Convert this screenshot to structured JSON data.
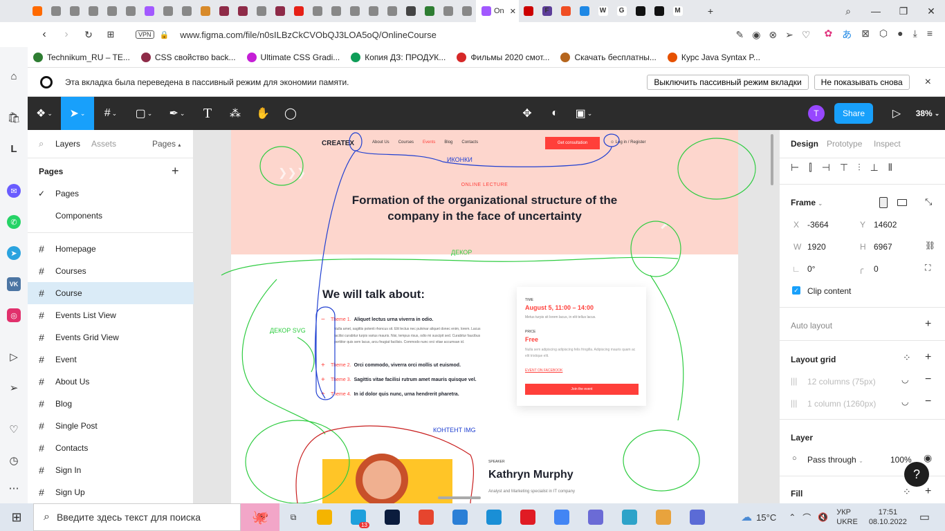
{
  "browser": {
    "active_tab_title": "On",
    "url": "www.figma.com/file/n0sILBzCkCVObQJ3LOA5oQ/OnlineCourse",
    "vpn_label": "VPN",
    "bookmarks": [
      {
        "label": "Technikum_RU – TE...",
        "color": "#2e7d32"
      },
      {
        "label": "CSS свойство back...",
        "color": "#8e2b48"
      },
      {
        "label": "Ultimate CSS Gradi...",
        "color": "#c51fd6"
      },
      {
        "label": "Копия ДЗ: ПРОДУК...",
        "color": "#0f9d58"
      },
      {
        "label": "Фильмы 2020 смот...",
        "color": "#d62828"
      },
      {
        "label": "Скачать бесплатны...",
        "color": "#b5651d"
      },
      {
        "label": "Курс Java Syntax P...",
        "color": "#e65100"
      }
    ],
    "tab_colors": [
      "#ff6a00",
      "#888",
      "#888",
      "#888",
      "#888",
      "#888",
      "#a259ff",
      "#888",
      "#888",
      "#d88a2a",
      "#8e2b48",
      "#8e2b48",
      "#888",
      "#8e2b48",
      "#e62117",
      "#888",
      "#888",
      "#888",
      "#888",
      "#888",
      "#444",
      "#2e7d32",
      "#888",
      "#888"
    ],
    "right_tab_colors": [
      "#c00",
      "#5c3d99",
      "#f04e23",
      "#1e88e5",
      "#fff",
      "#fff",
      "#111",
      "#111",
      "#fff"
    ],
    "right_tab_glyphs": [
      "",
      "F",
      "",
      "",
      "W",
      "G",
      "",
      "",
      "M"
    ]
  },
  "notice": {
    "text": "Эта вкладка была переведена в пассивный режим для экономии памяти.",
    "btn_disable": "Выключить пассивный режим вкладки",
    "btn_dont_show": "Не показывать снова",
    "close_glyph": "×"
  },
  "toolbar": {
    "avatar_letter": "T",
    "share_label": "Share",
    "zoom": "38%"
  },
  "left_panel": {
    "tab_layers": "Layers",
    "tab_assets": "Assets",
    "pages_dropdown": "Pages",
    "pages_header": "Pages",
    "page_items": [
      "Pages",
      "Components"
    ],
    "frames": [
      "Homepage",
      "Courses",
      "Course",
      "Events List View",
      "Events Grid View",
      "Event",
      "About Us",
      "Blog",
      "Single Post",
      "Contacts",
      "Sign In",
      "Sign Up"
    ],
    "selected_frame": "Course"
  },
  "design": {
    "logo": "CREATEX",
    "nav": [
      "About Us",
      "Courses",
      "Events",
      "Blog",
      "Contacts"
    ],
    "nav_active": "Events",
    "cta": "Get consultation",
    "login": "Log in / Register",
    "eyebrow": "ONLINE LECTURE",
    "title_line1": "Formation of the organizational structure of the",
    "title_line2": "company in the face of uncertainty",
    "talk_heading": "We will talk about:",
    "themes": [
      {
        "num": "Theme 1.",
        "text": "Aliquet lectus urna viverra in odio."
      },
      {
        "num": "Theme 2.",
        "text": "Orci commodo, viverra orci mollis ut euismod."
      },
      {
        "num": "Theme 3.",
        "text": "Sagittis vitae facilisi rutrum amet mauris quisque vel."
      },
      {
        "num": "Theme 4.",
        "text": "In id dolor quis nunc, urna hendrerit pharetra."
      }
    ],
    "theme1_body": "Nulla amet, sagittis potenti rhoncus sit. Elit lectus nec pulvinar aliquet donec enim, lorem. Lacus facilisi curabitur turpis varius mauris. Nisi, tempus risus, odio mi suscipit sed. Curabitur faucibus porttitor quis sem lacus, arcu feugiat facilisis. Commodo nunc orci vitae accumsan id.",
    "card_time_label": "TIME",
    "card_time": "August 5, 11:00 – 14:00",
    "card_time_sub": "Metus turpis sit lorem lacus, in elit tellus lacus.",
    "card_price_label": "PRICE",
    "card_price": "Free",
    "card_price_sub": "Nulla sem adipiscing adipiscing felis fringilla. Adipiscing mauris quam ac elit tristique elit.",
    "card_fb": "EVENT ON FACEBOOK",
    "card_btn": "Join the event",
    "speaker_label": "SPEAKER",
    "speaker_name": "Kathryn Murphy",
    "speaker_role": "Analyst and Marketing specialist in IT company",
    "annotations": {
      "icons": "ИКОНКИ",
      "decor": "ДЕКОР",
      "decor_svg": "ДЕКОР SVG",
      "content_img": "КОНТЕНТ IMG"
    }
  },
  "right_panel": {
    "tabs": [
      "Design",
      "Prototype",
      "Inspect"
    ],
    "frame_label": "Frame",
    "x_label": "X",
    "x": "-3664",
    "y_label": "Y",
    "y": "14602",
    "w_label": "W",
    "w": "1920",
    "h_label": "H",
    "h": "6967",
    "rotation": "0°",
    "radius": "0",
    "clip_content": "Clip content",
    "auto_layout": "Auto layout",
    "layout_grid": "Layout grid",
    "grid1": "12 columns (75px)",
    "grid2": "1 column (1260px)",
    "layer": "Layer",
    "blend": "Pass through",
    "opacity": "100%",
    "fill": "Fill",
    "help": "?"
  },
  "taskbar": {
    "search_placeholder": "Введите здесь текст для поиска",
    "weather": "15°C",
    "lang1": "УКР",
    "lang2": "UKRE",
    "time": "17:51",
    "date": "08.10.2022",
    "telegram_badge": "13",
    "apps": [
      "#f5b400",
      "#1ea0dc",
      "#0b1c3d",
      "#e6452e",
      "#2b7fd6",
      "#1a8fd6",
      "#e01b24",
      "#4285f4",
      "#6b6bd6",
      "#2ea3c9",
      "#e8a33d",
      "#5b6bd6"
    ]
  },
  "colors": {
    "accent_red": "#ff3f3a",
    "figma_blue": "#18a0fb",
    "hero_bg": "#fdd6cd",
    "annot_green": "#2ecc40",
    "annot_blue": "#1f3fd1"
  }
}
